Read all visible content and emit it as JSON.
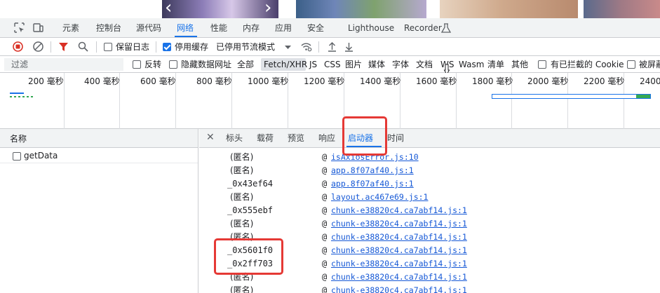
{
  "colors": {
    "accent": "#1a73e8",
    "link": "#1558d6",
    "annotation": "#e53935",
    "record": "#d93025",
    "filter_funnel": "#d93025"
  },
  "panel_tabs": {
    "items": [
      "元素",
      "控制台",
      "源代码",
      "网络",
      "性能",
      "内存",
      "应用",
      "安全",
      "Lighthouse",
      "Recorder"
    ],
    "active": "网络"
  },
  "toolbar": {
    "preserve_log_label": "保留日志",
    "disable_cache_label": "停用缓存",
    "throttling_value": "已停用节流模式"
  },
  "filter": {
    "placeholder": "过滤",
    "invert_label": "反转",
    "hide_data_urls_label": "隐藏数据网址",
    "types": [
      "全部",
      "Fetch/XHR",
      "JS",
      "CSS",
      "图片",
      "媒体",
      "字体",
      "文档",
      "WS",
      "Wasm",
      "清单",
      "其他"
    ],
    "active_type": "Fetch/XHR",
    "blocked_cookies_label": "有已拦截的 Cookie",
    "blocked_requests_label": "被屏蔽"
  },
  "timeline": {
    "ticks": [
      "200 毫秒",
      "400 毫秒",
      "600 毫秒",
      "800 毫秒",
      "1000 毫秒",
      "1200 毫秒",
      "1400 毫秒",
      "1600 毫秒",
      "1800 毫秒",
      "2000 毫秒",
      "2200 毫秒",
      "2400"
    ]
  },
  "requests": {
    "header": "名称",
    "rows": [
      {
        "name": "getData"
      }
    ]
  },
  "detail": {
    "tabs": [
      "标头",
      "载荷",
      "预览",
      "响应",
      "启动器",
      "时间"
    ],
    "active_tab": "启动器"
  },
  "stack": {
    "frames": [
      {
        "fn": "(匿名)",
        "at": "@",
        "source": "isAxiosError.js:10"
      },
      {
        "fn": "(匿名)",
        "at": "@",
        "source": "app.8f07af40.js:1"
      },
      {
        "fn": "_0x43ef64",
        "at": "@",
        "source": "app.8f07af40.js:1"
      },
      {
        "fn": "(匿名)",
        "at": "@",
        "source": "layout.ac467e69.js:1"
      },
      {
        "fn": "_0x555ebf",
        "at": "@",
        "source": "chunk-e38820c4.ca7abf14.js:1"
      },
      {
        "fn": "(匿名)",
        "at": "@",
        "source": "chunk-e38820c4.ca7abf14.js:1"
      },
      {
        "fn": "(匿名)",
        "at": "@",
        "source": "chunk-e38820c4.ca7abf14.js:1"
      },
      {
        "fn": "_0x5601f0",
        "at": "@",
        "source": "chunk-e38820c4.ca7abf14.js:1"
      },
      {
        "fn": "_0x2ff703",
        "at": "@",
        "source": "chunk-e38820c4.ca7abf14.js:1"
      },
      {
        "fn": "(匿名)",
        "at": "@",
        "source": "chunk-e38820c4.ca7abf14.js:1"
      },
      {
        "fn": "(匿名)",
        "at": "@",
        "source": "chunk-e38820c4.ca7abf14.js:1"
      }
    ]
  }
}
